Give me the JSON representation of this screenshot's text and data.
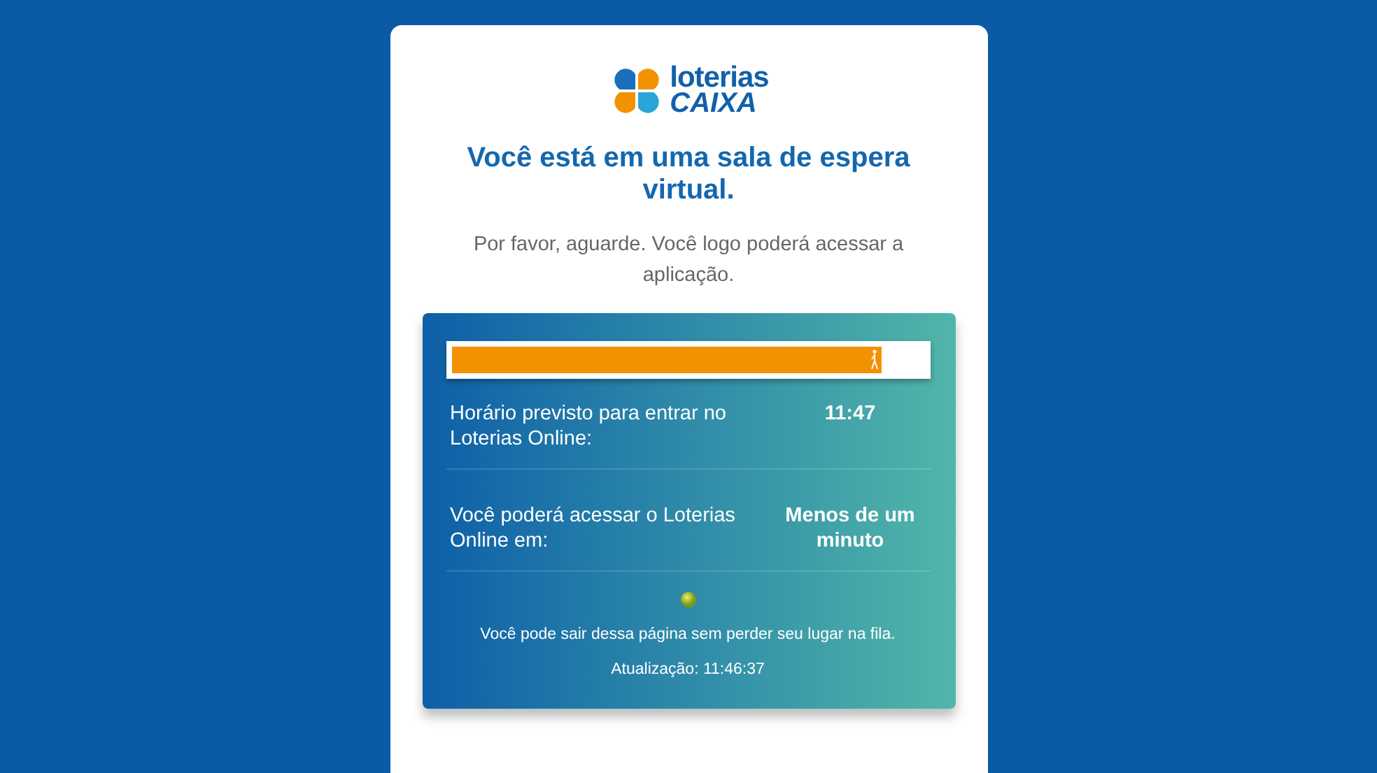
{
  "logo": {
    "word_top": "loterias",
    "word_bottom": "CAIXA"
  },
  "title": "Você está em uma sala de espera virtual.",
  "subtitle": "Por favor, aguarde. Você logo poderá acessar a aplicação.",
  "queue": {
    "progress": {
      "level": 0.91
    },
    "rows": [
      {
        "label": "Horário previsto para entrar no Loterias Online:",
        "value": "11:47"
      },
      {
        "label": "Você poderá acessar o Loterias Online em:",
        "value": "Menos de um minuto"
      }
    ],
    "notice": "Você pode sair dessa página sem perder seu lugar na fila.",
    "updated": "Atualização: 11:46:37"
  }
}
